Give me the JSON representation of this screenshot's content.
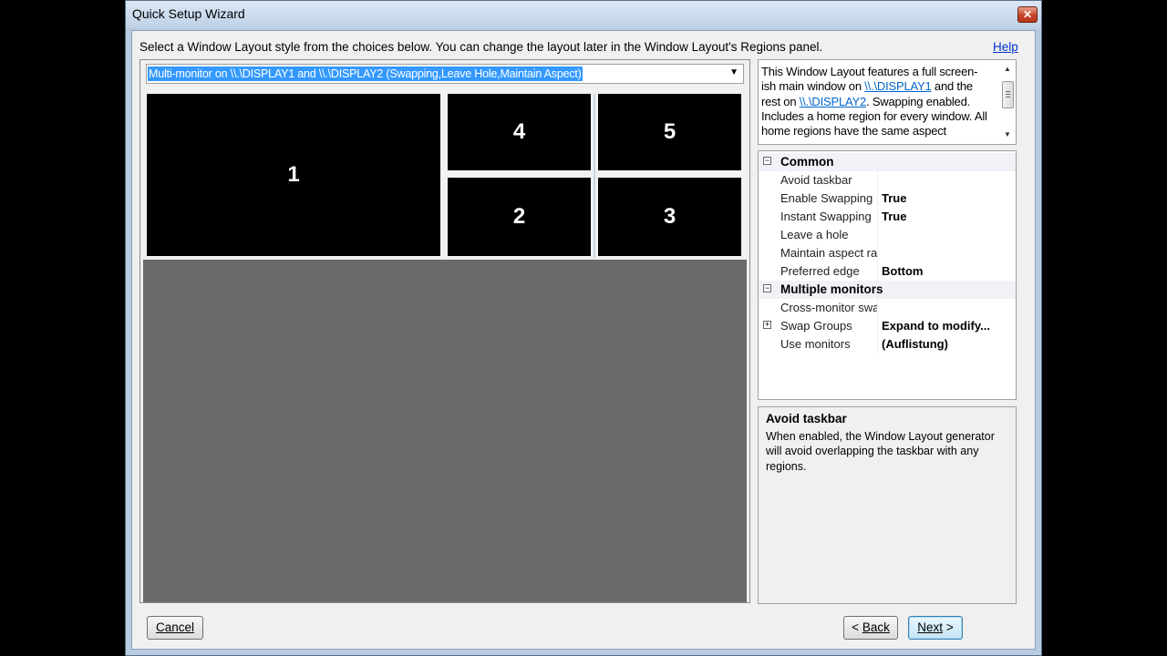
{
  "window": {
    "title": "Quick Setup Wizard",
    "close_glyph": "✕"
  },
  "instructions": "Select a Window Layout style from the choices below. You can change the layout later in the Window Layout's Regions panel.",
  "help_link": "Help",
  "layout_combo": {
    "selected": "Multi-monitor on \\\\.\\DISPLAY1 and \\\\.\\DISPLAY2 (Swapping,Leave Hole,Maintain Aspect)"
  },
  "preview": {
    "regions": [
      "1",
      "4",
      "5",
      "2",
      "3"
    ]
  },
  "description": {
    "part1": "This Window Layout features a full screen-ish main window on ",
    "link1": "\\\\.\\DISPLAY1",
    "part2": " and the rest on ",
    "link2": "\\\\.\\DISPLAY2",
    "part3": ". Swapping enabled. Includes a home region for every window. All home regions have the same aspect"
  },
  "properties": {
    "common_label": "Common",
    "multiple_label": "Multiple monitors",
    "rows": [
      {
        "name": "Avoid taskbar",
        "value": ""
      },
      {
        "name": "Enable Swapping",
        "value": "True"
      },
      {
        "name": "Instant Swapping",
        "value": "True"
      },
      {
        "name": "Leave a hole",
        "value": ""
      },
      {
        "name": "Maintain aspect ra",
        "value": ""
      },
      {
        "name": "Preferred edge",
        "value": "Bottom"
      },
      {
        "name": "Cross-monitor swa",
        "value": ""
      },
      {
        "name": "Swap Groups",
        "value": "Expand to modify..."
      },
      {
        "name": "Use monitors",
        "value": "(Auflistung)"
      }
    ]
  },
  "help_panel": {
    "title": "Avoid taskbar",
    "body": "When enabled, the Window Layout generator will avoid overlapping the taskbar with any regions."
  },
  "buttons": {
    "cancel": "Cancel",
    "back_prefix": "< ",
    "back": "Back",
    "next": "Next",
    "next_suffix": " >"
  }
}
